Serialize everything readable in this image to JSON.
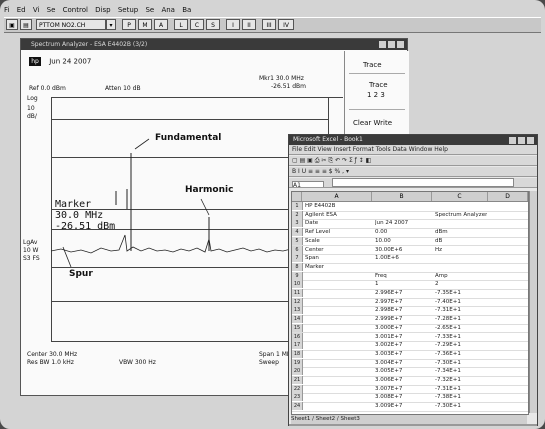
{
  "menubar": [
    "Fi",
    "Ed",
    "Vi",
    "Se",
    "Control",
    "Disp",
    "Setup",
    "Se",
    "Ana",
    "Ba"
  ],
  "toolbar": {
    "combo_value": "PTTOM NO2.CH",
    "buttons": [
      "P",
      "M",
      "A",
      "L",
      "C",
      "S",
      "I",
      "II",
      "III",
      "IV"
    ]
  },
  "analyzer": {
    "title": "Spectrum Analyzer - ESA E4402B (3/2)",
    "header": "Jun 24 2007",
    "ref_level": "Ref 0.0 dBm",
    "atten": "Atten 10 dB",
    "marker_readout": "Mkr1 30.0 MHz",
    "marker_value": "-26.51 dBm",
    "scale_top": "Log",
    "scale_div": "10",
    "scale_unit": "dB/",
    "left_labels": [
      "LgAv",
      "10 W",
      "S3 FS"
    ],
    "center_freq": "Center 30.0 MHz",
    "res_bw": "Res BW 1.0 kHz",
    "vbw": "VBW 300 Hz",
    "span": "Span 1 MHz",
    "sweep": "Sweep",
    "panel_title": "Trace",
    "panel_items": [
      "Trace",
      "1 2 3",
      "Clear Write"
    ],
    "marker_box_line1": "Marker",
    "marker_box_line2": "30.0 MHz",
    "marker_box_line3": "-26.51 dBm",
    "annot_fundamental": "Fundamental",
    "annot_harmonic": "Harmonic",
    "annot_spur": "Spur"
  },
  "excel": {
    "title": "Microsoft Excel - Book1",
    "menu": "File Edit View Insert Format Tools Data Window Help",
    "name_box": "A1",
    "columns": [
      "",
      "A",
      "B",
      "C",
      "D"
    ],
    "rows": [
      [
        "1",
        "HP E4402B",
        "",
        "",
        ""
      ],
      [
        "2",
        "Agilent ESA",
        "",
        "Spectrum Analyzer",
        ""
      ],
      [
        "3",
        "Date",
        "Jun 24 2007",
        "",
        ""
      ],
      [
        "4",
        "Ref Level",
        "0.00",
        "dBm",
        ""
      ],
      [
        "5",
        "Scale",
        "10.00",
        "dB",
        ""
      ],
      [
        "6",
        "Center",
        "30.00E+6",
        "Hz",
        ""
      ],
      [
        "7",
        "Span",
        "1.00E+6",
        "",
        ""
      ],
      [
        "8",
        "Marker",
        "",
        "",
        ""
      ],
      [
        "9",
        "",
        "Freq",
        "Amp",
        ""
      ],
      [
        "10",
        "",
        "1",
        "2",
        ""
      ],
      [
        "11",
        "",
        "2.996E+7",
        "-7.35E+1",
        ""
      ],
      [
        "12",
        "",
        "2.997E+7",
        "-7.40E+1",
        ""
      ],
      [
        "13",
        "",
        "2.998E+7",
        "-7.31E+1",
        ""
      ],
      [
        "14",
        "",
        "2.999E+7",
        "-7.28E+1",
        ""
      ],
      [
        "15",
        "",
        "3.000E+7",
        "-2.65E+1",
        ""
      ],
      [
        "16",
        "",
        "3.001E+7",
        "-7.33E+1",
        ""
      ],
      [
        "17",
        "",
        "3.002E+7",
        "-7.29E+1",
        ""
      ],
      [
        "18",
        "",
        "3.003E+7",
        "-7.36E+1",
        ""
      ],
      [
        "19",
        "",
        "3.004E+7",
        "-7.30E+1",
        ""
      ],
      [
        "20",
        "",
        "3.005E+7",
        "-7.34E+1",
        ""
      ],
      [
        "21",
        "",
        "3.006E+7",
        "-7.32E+1",
        ""
      ],
      [
        "22",
        "",
        "3.007E+7",
        "-7.31E+1",
        ""
      ],
      [
        "23",
        "",
        "3.008E+7",
        "-7.38E+1",
        ""
      ],
      [
        "24",
        "",
        "3.009E+7",
        "-7.30E+1",
        ""
      ]
    ],
    "sheet_tabs": "Sheet1 / Sheet2 / Sheet3"
  }
}
